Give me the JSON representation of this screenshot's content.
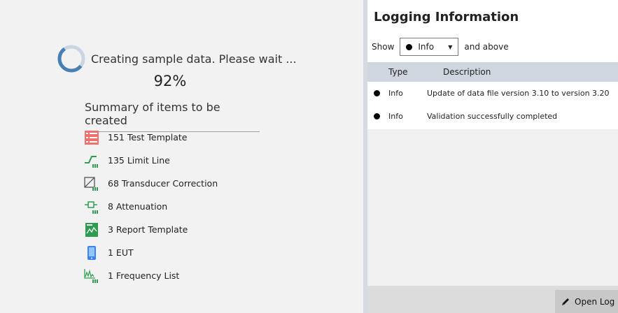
{
  "progress": {
    "status_text": "Creating sample data. Please wait ...",
    "percent_text": "92%",
    "fraction": 0.92
  },
  "summary": {
    "title": "Summary of items to be created",
    "items": [
      {
        "label": "151 Test Template",
        "icon": "test-template-icon"
      },
      {
        "label": "135 Limit Line",
        "icon": "limit-line-icon"
      },
      {
        "label": "68 Transducer Correction",
        "icon": "transducer-correction-icon"
      },
      {
        "label": "8 Attenuation",
        "icon": "attenuation-icon"
      },
      {
        "label": "3 Report Template",
        "icon": "report-template-icon"
      },
      {
        "label": "1 EUT",
        "icon": "eut-icon"
      },
      {
        "label": "1 Frequency List",
        "icon": "frequency-list-icon"
      }
    ]
  },
  "logging": {
    "title": "Logging Information",
    "show_label": "Show",
    "filter_value": "Info",
    "and_above_label": "and above",
    "columns": {
      "type": "Type",
      "description": "Description"
    },
    "rows": [
      {
        "type": "Info",
        "description": "Update of data file version 3.10 to version 3.20"
      },
      {
        "type": "Info",
        "description": "Validation successfully completed"
      }
    ],
    "open_log_label": "Open Log"
  },
  "colors": {
    "accent": "#4a7fb5",
    "header_bg": "#cfd6e0",
    "test_template": "#f07070",
    "report_template": "#2e9e4e",
    "eut": "#3b82f6"
  }
}
